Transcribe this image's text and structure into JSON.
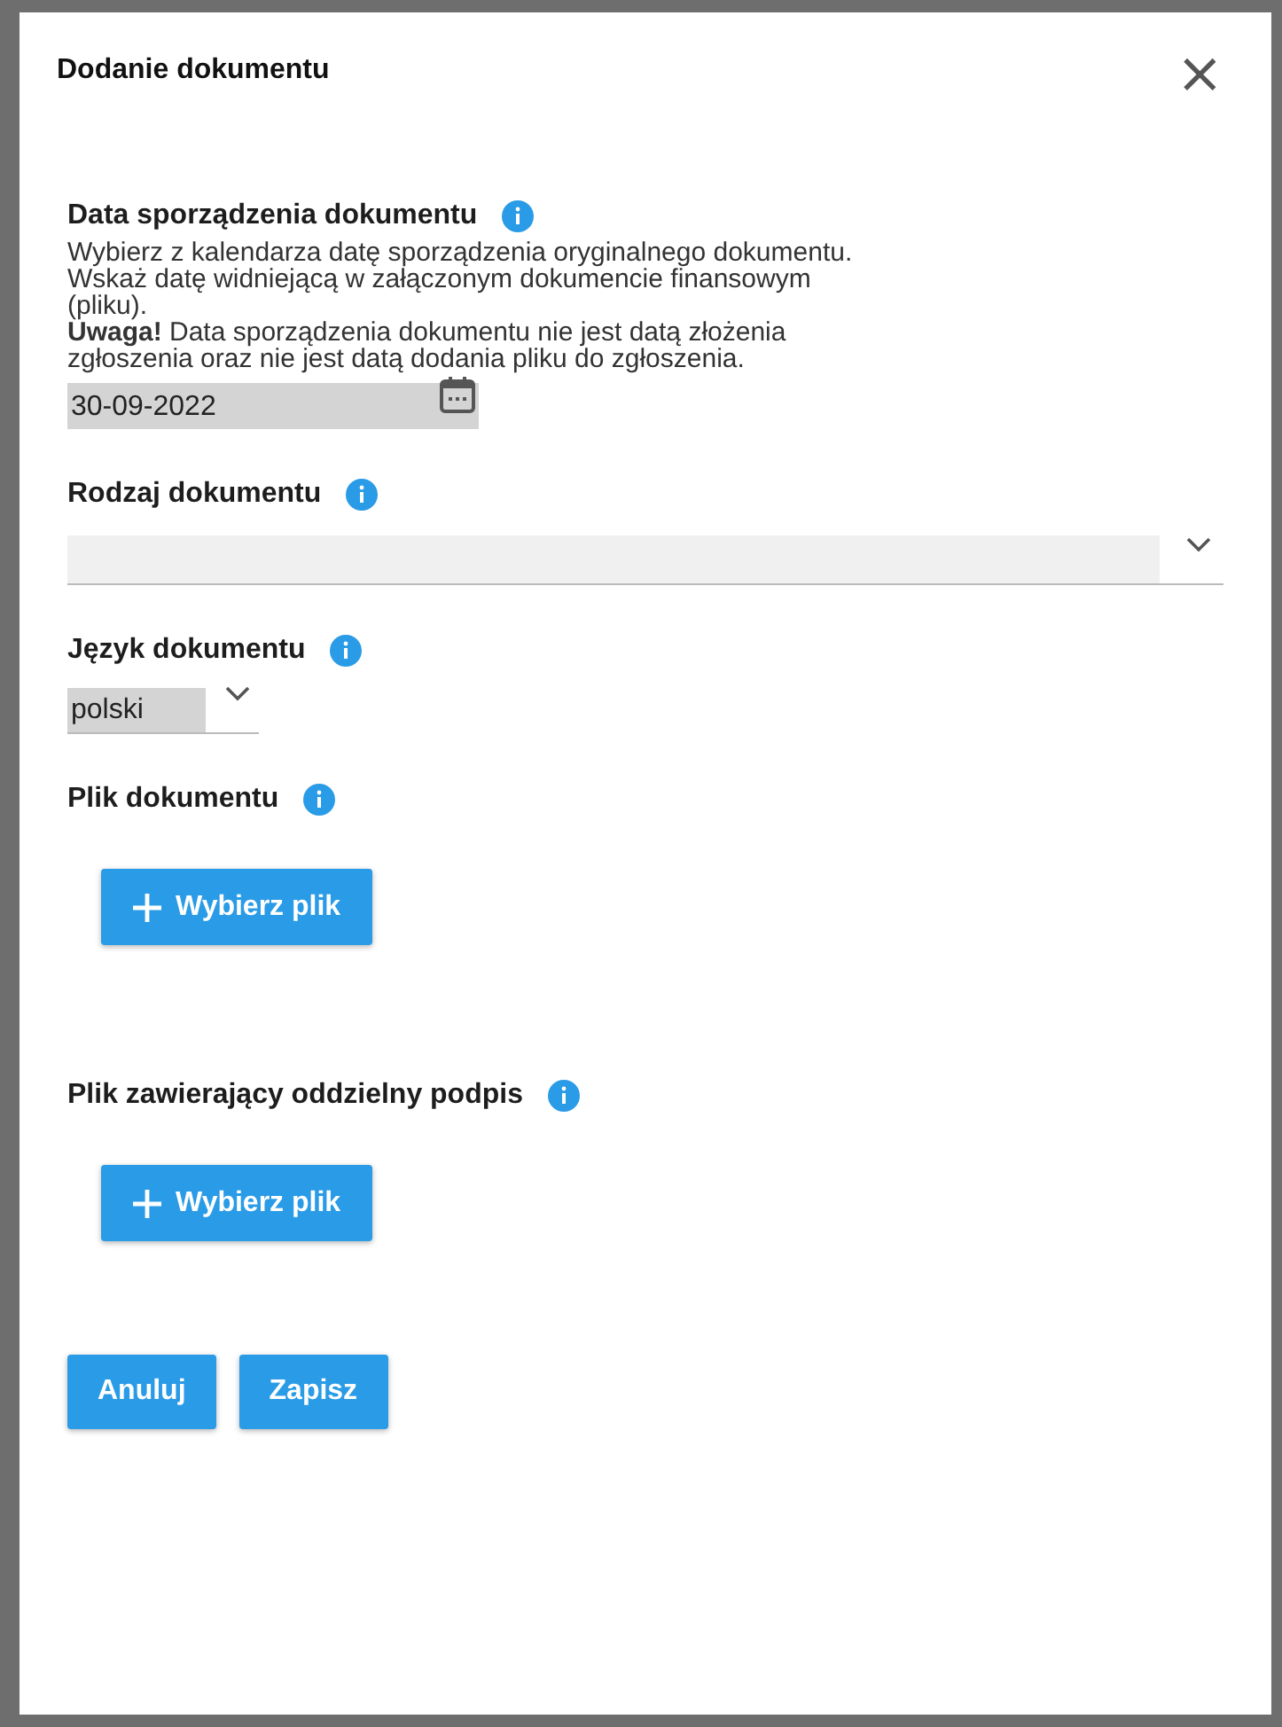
{
  "dialog": {
    "title": "Dodanie dokumentu",
    "close": "×"
  },
  "fields": [
    {
      "kind": "date",
      "label": "Data sporządzenia dokumentu",
      "description": [
        "Wybierz z kalendarza datę sporządzenia oryginalnego dokumentu. Wskaż datę widniejącą w załączonym dokumencie finansowym (pliku).",
        "**Uwaga!** Data sporządzenia dokumentu nie jest datą złożenia zgłoszenia oraz nie jest datą dodania pliku do zgłoszenia."
      ],
      "value": "30-09-2022"
    },
    {
      "kind": "select-wide",
      "label": "Rodzaj dokumentu"
    },
    {
      "kind": "select-small",
      "label": "Język dokumentu",
      "value": "polski"
    },
    {
      "kind": "file",
      "label": "Plik dokumentu",
      "button": "Wybierz plik"
    },
    {
      "kind": "file",
      "label": "Plik zawierający oddzielny podpis",
      "button": "Wybierz plik"
    }
  ],
  "buttons": [
    "Anuluj",
    "Zapisz"
  ]
}
